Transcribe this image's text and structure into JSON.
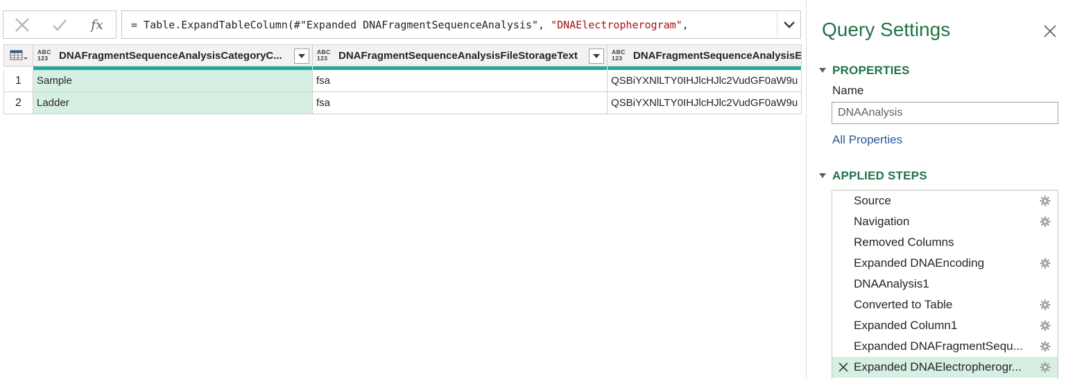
{
  "formula": {
    "prefix": "= Table.ExpandTableColumn(#\"Expanded DNAFragmentSequenceAnalysis\", ",
    "string_arg": "\"DNAElectropherogram\"",
    "suffix": ",",
    "fx_label": "fx"
  },
  "table": {
    "type_icon_top": "ABC",
    "type_icon_bottom": "123",
    "columns": [
      {
        "name": "DNAFragmentSequenceAnalysisCategoryC..."
      },
      {
        "name": "DNAFragmentSequenceAnalysisFileStorageText"
      },
      {
        "name": "DNAFragmentSequenceAnalysisE"
      }
    ],
    "rows": [
      {
        "index": "1",
        "cells": [
          "Sample",
          "fsa",
          "QSBiYXNlLTY0IHJlcHJlc2VudGF0aW9u"
        ]
      },
      {
        "index": "2",
        "cells": [
          "Ladder",
          "fsa",
          "QSBiYXNlLTY0IHJlcHJlc2VudGF0aW9u"
        ]
      }
    ]
  },
  "query_settings": {
    "title": "Query Settings",
    "properties_heading": "PROPERTIES",
    "name_label": "Name",
    "name_value": "DNAAnalysis",
    "all_properties_link": "All Properties",
    "applied_steps_heading": "APPLIED STEPS",
    "steps": [
      {
        "label": "Source",
        "gear": true,
        "active": false
      },
      {
        "label": "Navigation",
        "gear": true,
        "active": false
      },
      {
        "label": "Removed Columns",
        "gear": false,
        "active": false
      },
      {
        "label": "Expanded DNAEncoding",
        "gear": true,
        "active": false
      },
      {
        "label": "DNAAnalysis1",
        "gear": false,
        "active": false
      },
      {
        "label": "Converted to Table",
        "gear": true,
        "active": false
      },
      {
        "label": "Expanded Column1",
        "gear": true,
        "active": false
      },
      {
        "label": "Expanded DNAFragmentSequ...",
        "gear": true,
        "active": false
      },
      {
        "label": "Expanded DNAElectropherogr...",
        "gear": true,
        "active": true
      }
    ]
  },
  "colors": {
    "accent_green": "#217346",
    "quality_bar": "#17ad9b",
    "selected_fill": "#d6efe3",
    "link_blue": "#2b5797",
    "formula_string": "#a31515"
  }
}
